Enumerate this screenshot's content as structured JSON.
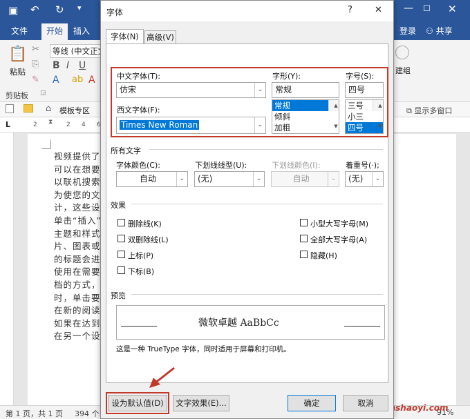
{
  "word": {
    "tabs": [
      "文件",
      "开始",
      "插入"
    ],
    "login": "登录",
    "share": "共享",
    "ribbon": {
      "font_name": "等线 (中文正文",
      "paste": "粘贴",
      "clipboard": "剪贴板",
      "right_group": "建组"
    },
    "nav": {
      "template_zone": "模板专区",
      "multi_window": "显示多窗口"
    },
    "ruler_numbers": [
      "2",
      "2",
      "4",
      "6"
    ],
    "doc_lines": [
      "视频提供了",
      "可以在想要",
      "以联机搜索",
      "为使您的文",
      "计，这些设",
      "单击“插入”",
      "主题和样式",
      "片、图表或",
      "的标题会进",
      "使用在需要",
      "档的方式，",
      "时，单击要",
      "在新的阅读",
      "如果在达到",
      "在另一个设"
    ],
    "status": {
      "page": "第 1 页，共 1 页",
      "words": "394 个",
      "zoom": "91%"
    },
    "watermark": "zhanshaoyi.com"
  },
  "dialog": {
    "title": "字体",
    "help": "?",
    "close": "✕",
    "tabs": [
      "字体(N)",
      "高级(V)"
    ],
    "chinese_font_label": "中文字体(T):",
    "chinese_font_value": "仿宋",
    "western_font_label": "西文字体(F):",
    "western_font_value": "Times New Roman",
    "style_label": "字形(Y):",
    "style_value": "常规",
    "style_options": [
      "常规",
      "倾斜",
      "加粗"
    ],
    "size_label": "字号(S):",
    "size_value": "四号",
    "size_options": [
      "三号",
      "小三",
      "四号"
    ],
    "all_text": "所有文字",
    "font_color_label": "字体颜色(C):",
    "font_color_value": "自动",
    "underline_style_label": "下划线线型(U):",
    "underline_style_value": "(无)",
    "underline_color_label": "下划线颜色(I):",
    "underline_color_value": "自动",
    "emphasis_label": "着重号(·);",
    "emphasis_value": "(无)",
    "effects": "效果",
    "effects_left": [
      "删除线(K)",
      "双删除线(L)",
      "上标(P)",
      "下标(B)"
    ],
    "effects_right": [
      "小型大写字母(M)",
      "全部大写字母(A)",
      "隐藏(H)"
    ],
    "preview": "预览",
    "preview_text": "微软卓越 AaBbCc",
    "description": "这是一种 TrueType 字体，同时适用于屏幕和打印机。",
    "set_default": "设为默认值(D)",
    "text_effects": "文字效果(E)...",
    "ok": "确定",
    "cancel": "取消"
  },
  "colors": {
    "word_blue": "#2b579a",
    "highlight": "#0078d7",
    "annotation_red": "#c0392b"
  }
}
